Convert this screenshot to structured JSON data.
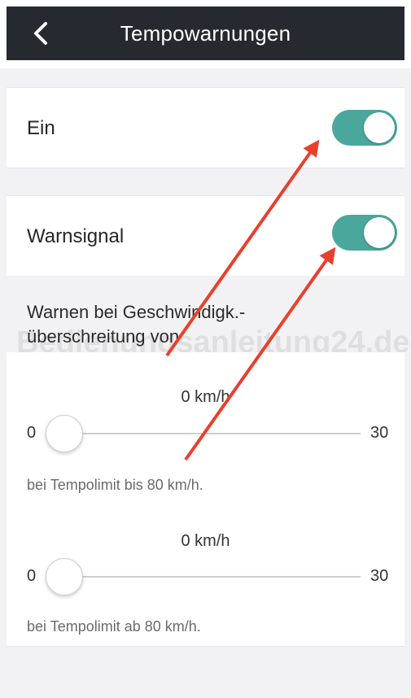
{
  "navbar": {
    "title": "Tempowarnungen",
    "back_icon": "chevron-left-icon"
  },
  "settings": {
    "enabled": {
      "label": "Ein",
      "on": true
    },
    "warning_signal": {
      "label": "Warnsignal",
      "on": true
    }
  },
  "description": "Warnen bei Geschwindigk.-überschreitung von",
  "watermark": "Bedienungsanleitung24.de",
  "sliders": [
    {
      "value_label": "0 km/h",
      "min": "0",
      "max": "30",
      "value": 0,
      "caption": "bei Tempolimit bis 80 km/h."
    },
    {
      "value_label": "0 km/h",
      "min": "0",
      "max": "30",
      "value": 0,
      "caption": "bei Tempolimit ab 80 km/h."
    }
  ],
  "colors": {
    "navbar": "#262930",
    "toggle_on": "#4aa79c",
    "annotation_arrow": "#e8402c"
  }
}
